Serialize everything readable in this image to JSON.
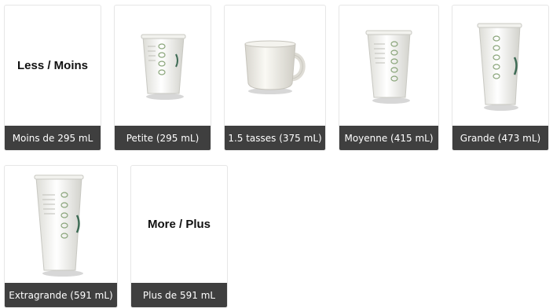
{
  "options": [
    {
      "id": "less",
      "label": "Moins de 295 mL",
      "heading": "Less / Moins"
    },
    {
      "id": "petite",
      "label": "Petite (295 mL)"
    },
    {
      "id": "mug",
      "label": "1.5 tasses (375 mL)"
    },
    {
      "id": "moyenne",
      "label": "Moyenne (415 mL)"
    },
    {
      "id": "grande",
      "label": "Grande (473 mL)"
    },
    {
      "id": "extragrande",
      "label": "Extragrande (591 mL)"
    },
    {
      "id": "more",
      "label": "Plus de 591 mL",
      "heading": "More / Plus"
    }
  ]
}
